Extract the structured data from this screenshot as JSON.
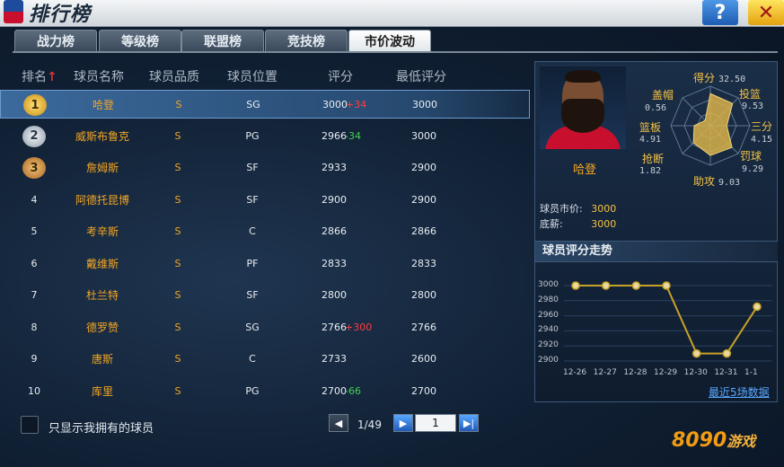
{
  "window": {
    "title": "排行榜",
    "help": "?",
    "close": "✕"
  },
  "tabs": [
    {
      "label": "战力榜",
      "active": false
    },
    {
      "label": "等级榜",
      "active": false
    },
    {
      "label": "联盟榜",
      "active": false
    },
    {
      "label": "竞技榜",
      "active": false
    },
    {
      "label": "市价波动",
      "active": true
    }
  ],
  "table": {
    "headers": {
      "rank": "排名",
      "name": "球员名称",
      "quality": "球员品质",
      "position": "球员位置",
      "rating": "评分",
      "min_rating": "最低评分"
    },
    "rows": [
      {
        "rank": "1",
        "name": "哈登",
        "quality": "S",
        "position": "SG",
        "rating": "3000",
        "delta": "+34",
        "dir": "up",
        "min": "3000"
      },
      {
        "rank": "2",
        "name": "威斯布鲁克",
        "quality": "S",
        "position": "PG",
        "rating": "2966",
        "delta": "-34",
        "dir": "down",
        "min": "3000"
      },
      {
        "rank": "3",
        "name": "詹姆斯",
        "quality": "S",
        "position": "SF",
        "rating": "2933",
        "delta": "",
        "dir": "",
        "min": "2900"
      },
      {
        "rank": "4",
        "name": "阿德托昆博",
        "quality": "S",
        "position": "SF",
        "rating": "2900",
        "delta": "",
        "dir": "",
        "min": "2900"
      },
      {
        "rank": "5",
        "name": "考辛斯",
        "quality": "S",
        "position": "C",
        "rating": "2866",
        "delta": "",
        "dir": "",
        "min": "2866"
      },
      {
        "rank": "6",
        "name": "戴维斯",
        "quality": "S",
        "position": "PF",
        "rating": "2833",
        "delta": "",
        "dir": "",
        "min": "2833"
      },
      {
        "rank": "7",
        "name": "杜兰特",
        "quality": "S",
        "position": "SF",
        "rating": "2800",
        "delta": "",
        "dir": "",
        "min": "2800"
      },
      {
        "rank": "8",
        "name": "德罗赞",
        "quality": "S",
        "position": "SG",
        "rating": "2766",
        "delta": "+300",
        "dir": "up",
        "min": "2766"
      },
      {
        "rank": "9",
        "name": "唐斯",
        "quality": "S",
        "position": "C",
        "rating": "2733",
        "delta": "",
        "dir": "",
        "min": "2600"
      },
      {
        "rank": "10",
        "name": "库里",
        "quality": "S",
        "position": "PG",
        "rating": "2700",
        "delta": "-66",
        "dir": "down",
        "min": "2700"
      }
    ]
  },
  "filter": {
    "label": "只显示我拥有的球员",
    "checked": false
  },
  "pagination": {
    "text": "1/49",
    "page_input": "1"
  },
  "player": {
    "name": "哈登",
    "market_label": "球员市价:",
    "market_value": "3000",
    "salary_label": "底薪:",
    "salary_value": "3000",
    "radar": [
      {
        "label": "得分",
        "value": "32.50"
      },
      {
        "label": "投篮",
        "value": "9.53"
      },
      {
        "label": "三分",
        "value": "4.15"
      },
      {
        "label": "罚球",
        "value": "9.29"
      },
      {
        "label": "助攻",
        "value": "9.03"
      },
      {
        "label": "抢断",
        "value": "1.82"
      },
      {
        "label": "篮板",
        "value": "4.91"
      },
      {
        "label": "盖帽",
        "value": "0.56"
      }
    ]
  },
  "trend": {
    "title": "球员评分走势",
    "link": "最近5场数据",
    "colors": {
      "line": "#c8a227",
      "point": "#e8d9a0"
    }
  },
  "chart_data": {
    "type": "line",
    "x": [
      "12-26",
      "12-27",
      "12-28",
      "12-29",
      "12-30",
      "12-31",
      "1-1"
    ],
    "y_ticks": [
      "3000",
      "2980",
      "2960",
      "2940",
      "2920",
      "2900"
    ],
    "ylim": [
      2900,
      3000
    ],
    "series": [
      {
        "values": [
          3000,
          3000,
          3000,
          3000,
          2910,
          2910,
          2972
        ]
      }
    ]
  },
  "brand": {
    "logo": "8090",
    "suffix": "游戏"
  }
}
